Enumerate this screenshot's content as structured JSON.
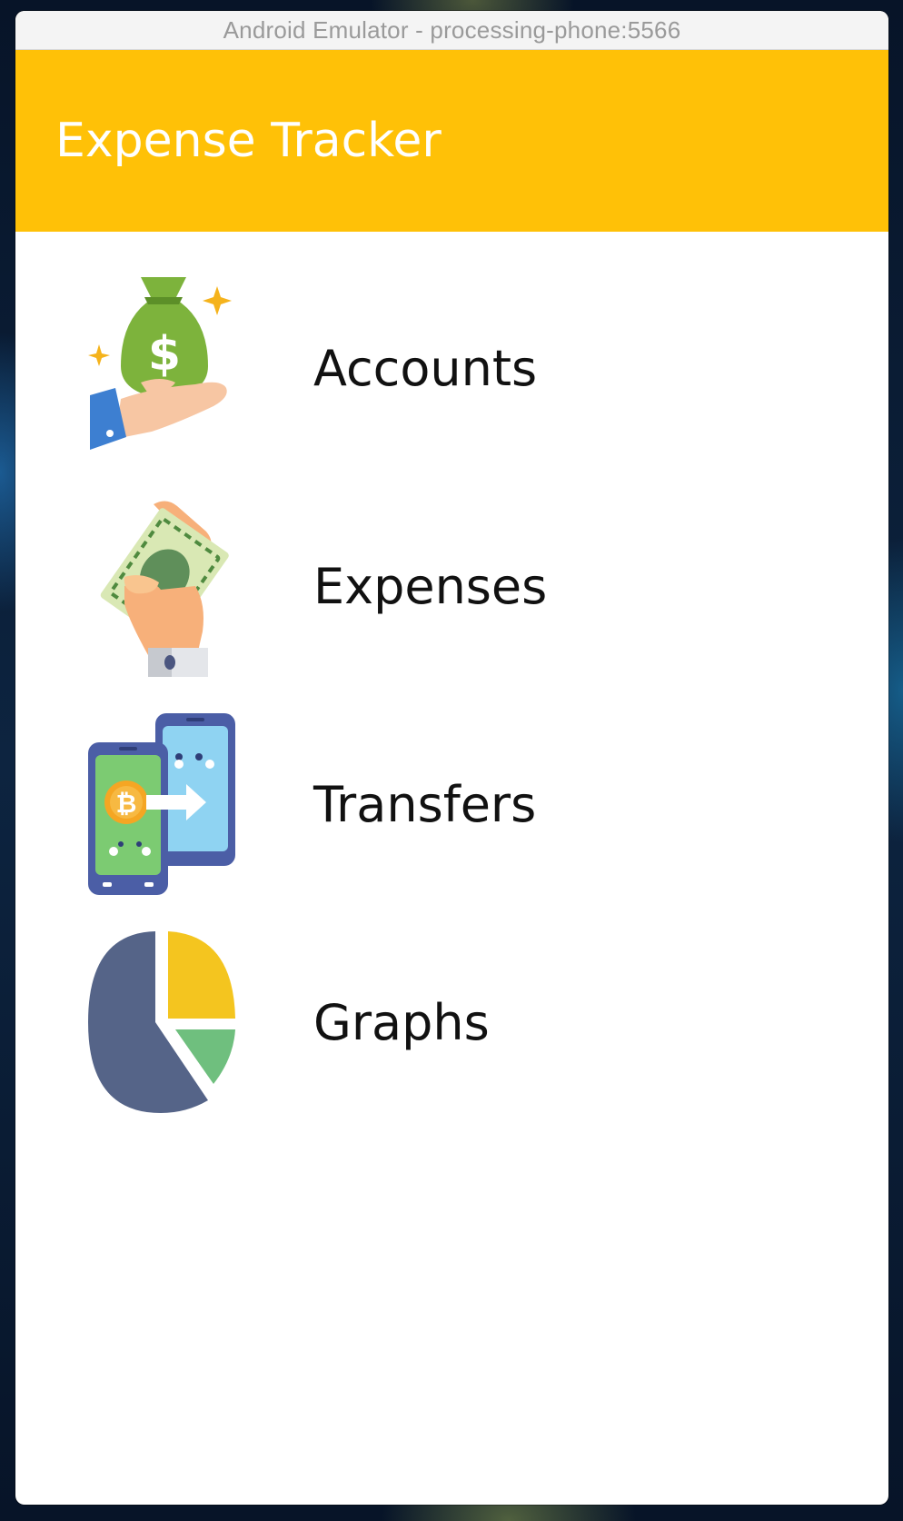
{
  "window": {
    "title": "Android Emulator - processing-phone:5566"
  },
  "appbar": {
    "title": "Expense Tracker",
    "color": "#ffc107"
  },
  "menu": {
    "items": [
      {
        "label": "Accounts",
        "icon": "money-bag-hand-icon"
      },
      {
        "label": "Expenses",
        "icon": "cash-in-hand-icon"
      },
      {
        "label": "Transfers",
        "icon": "phone-transfer-icon"
      },
      {
        "label": "Graphs",
        "icon": "pie-chart-icon"
      }
    ]
  }
}
